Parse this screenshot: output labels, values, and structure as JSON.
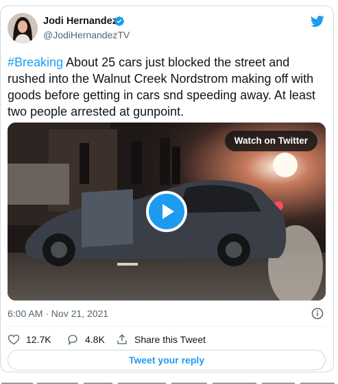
{
  "author": {
    "name": "Jodi Hernandez",
    "handle": "@JodiHernandezTV",
    "avatar_icon": "profile-photo",
    "verified_icon": "verified-badge-icon"
  },
  "brand_icon": "twitter-bird-icon",
  "tweet": {
    "hashtag": "#Breaking",
    "text": " About 25 cars just blocked the street and rushed into the Walnut Creek Nordstrom making off with goods before getting in cars snd speeding away. At least two people arrested at gunpoint."
  },
  "media": {
    "watch_label": "Watch on Twitter",
    "play_icon": "play-icon"
  },
  "timestamp": "6:00 AM · Nov 21, 2021",
  "info_icon": "info-icon",
  "actions": {
    "likes": "12.7K",
    "replies": "4.8K",
    "share_label": "Share this Tweet"
  },
  "reply_button": "Tweet your reply",
  "colors": {
    "accent": "#1d9bf0",
    "text": "#0f1419",
    "secondary": "#536471",
    "border": "#cfd9de"
  }
}
